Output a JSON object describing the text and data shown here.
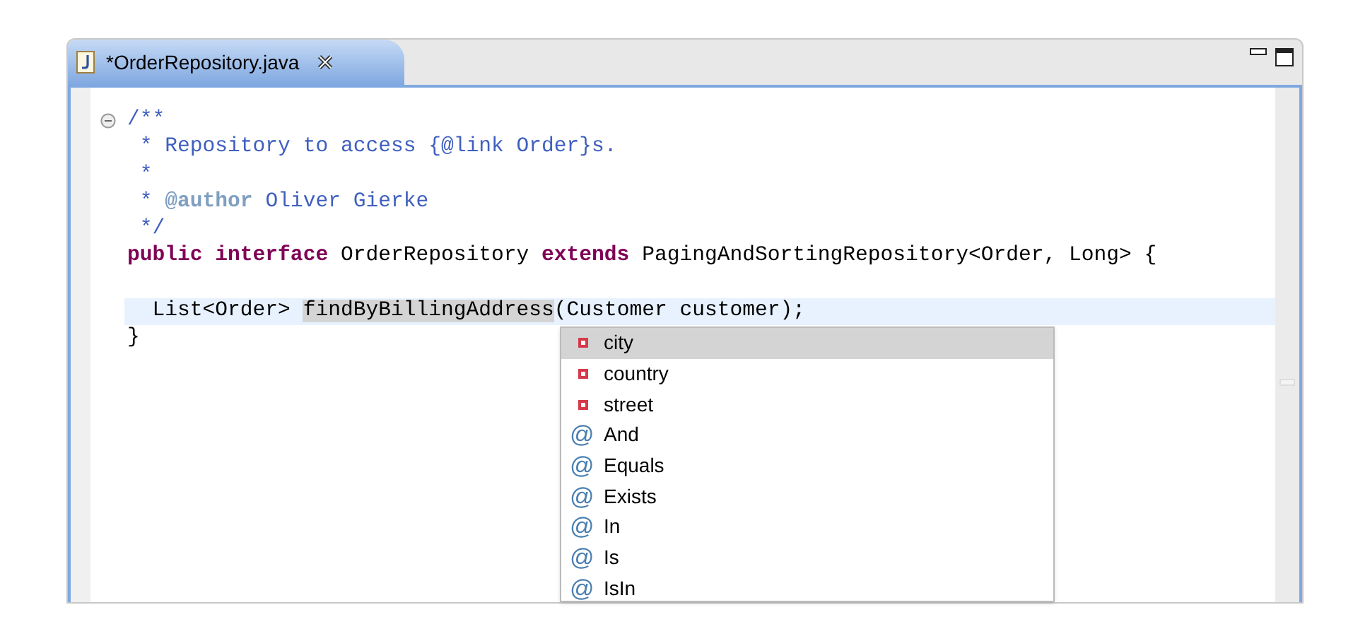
{
  "tab": {
    "title": "*OrderRepository.java",
    "selected": true
  },
  "code_lines": [
    {
      "foldable": true,
      "current": false,
      "segments": [
        {
          "kind": "comment",
          "text": "/**"
        }
      ]
    },
    {
      "foldable": false,
      "current": false,
      "segments": [
        {
          "kind": "comment",
          "text": " * Repository to access {@link Order}s."
        }
      ]
    },
    {
      "foldable": false,
      "current": false,
      "segments": [
        {
          "kind": "comment",
          "text": " *"
        }
      ]
    },
    {
      "foldable": false,
      "current": false,
      "segments": [
        {
          "kind": "comment",
          "text": " * "
        },
        {
          "kind": "doctag",
          "text": "@author"
        },
        {
          "kind": "comment",
          "text": " Oliver Gierke"
        }
      ]
    },
    {
      "foldable": false,
      "current": false,
      "segments": [
        {
          "kind": "comment",
          "text": " */"
        }
      ]
    },
    {
      "foldable": false,
      "current": false,
      "segments": [
        {
          "kind": "keyword",
          "text": "public interface"
        },
        {
          "kind": "plain",
          "text": " OrderRepository "
        },
        {
          "kind": "keyword",
          "text": "extends"
        },
        {
          "kind": "plain",
          "text": " PagingAndSortingRepository<Order, Long> {"
        }
      ]
    },
    {
      "foldable": false,
      "current": false
    },
    {
      "foldable": false,
      "current": true,
      "segments": [
        {
          "kind": "plain",
          "text": "  List<Order> "
        },
        {
          "kind": "highlight",
          "text": "findByBillingAddress"
        },
        {
          "kind": "plain",
          "text": "(Customer customer);"
        }
      ]
    },
    {
      "foldable": false,
      "current": false,
      "segments": [
        {
          "kind": "plain",
          "text": "}"
        }
      ]
    }
  ],
  "completion_popup": [
    {
      "kind": "field",
      "label": "city",
      "selected": true
    },
    {
      "kind": "field",
      "label": "country",
      "selected": false
    },
    {
      "kind": "field",
      "label": "street",
      "selected": false
    },
    {
      "kind": "keyword",
      "icon": "@",
      "label": "And",
      "selected": false
    },
    {
      "kind": "keyword",
      "icon": "@",
      "label": "Equals",
      "selected": false
    },
    {
      "kind": "keyword",
      "icon": "@",
      "label": "Exists",
      "selected": false
    },
    {
      "kind": "keyword",
      "icon": "@",
      "label": "In",
      "selected": false
    },
    {
      "kind": "keyword",
      "icon": "@",
      "label": "Is",
      "selected": false
    },
    {
      "kind": "keyword",
      "icon": "@",
      "label": "IsIn",
      "selected": false
    }
  ]
}
